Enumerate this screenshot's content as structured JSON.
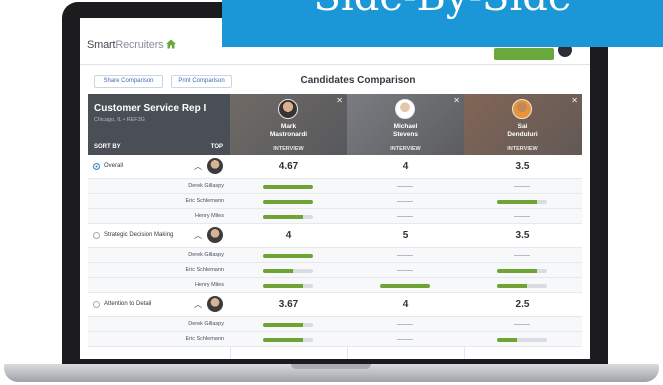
{
  "banner": {
    "text": "Side-By-Side"
  },
  "app": {
    "logo_bold": "Smart",
    "logo_light": "Recruiters",
    "icons": {
      "home": "home-icon"
    }
  },
  "toolbar": {
    "share_label": "Share Comparison",
    "print_label": "Print Comparison",
    "title": "Candidates Comparison"
  },
  "job": {
    "title": "Customer Service Rep I",
    "location": "Chicago, IL  •  REF3G",
    "sort_by": "SORT BY",
    "top": "TOP"
  },
  "candidates": [
    {
      "first": "Mark",
      "last": "Mastronardi",
      "stage": "INTERVIEW"
    },
    {
      "first": "Michael",
      "last": "Stevens",
      "stage": "INTERVIEW"
    },
    {
      "first": "Sai",
      "last": "Denduluri",
      "stage": "INTERVIEW"
    }
  ],
  "colors": {
    "accent": "#1b96d6",
    "bar": "#6fa336",
    "header": "#4a4e55"
  },
  "criteria": [
    {
      "label": "Overall",
      "selected": true,
      "scores": [
        "4.67",
        "4",
        "3.5"
      ],
      "reviewers": [
        {
          "name": "Derek Gillaspy",
          "fills": [
            1,
            null,
            null
          ]
        },
        {
          "name": "Eric Schlemann",
          "fills": [
            1,
            null,
            0.8
          ]
        },
        {
          "name": "Henry Miles",
          "fills": [
            0.8,
            null,
            null
          ]
        }
      ]
    },
    {
      "label": "Strategic Decision Making",
      "selected": false,
      "scores": [
        "4",
        "5",
        "3.5"
      ],
      "reviewers": [
        {
          "name": "Derek Gillaspy",
          "fills": [
            1,
            null,
            null
          ]
        },
        {
          "name": "Eric Schlemann",
          "fills": [
            0.6,
            null,
            0.8
          ]
        },
        {
          "name": "Henry Miles",
          "fills": [
            0.8,
            1,
            0.6
          ]
        }
      ]
    },
    {
      "label": "Attention to Detail",
      "selected": false,
      "scores": [
        "3.67",
        "4",
        "2.5"
      ],
      "reviewers": [
        {
          "name": "Derek Gillaspy",
          "fills": [
            0.8,
            null,
            null
          ]
        },
        {
          "name": "Eric Schlemann",
          "fills": [
            0.8,
            null,
            0.4
          ]
        }
      ]
    }
  ]
}
